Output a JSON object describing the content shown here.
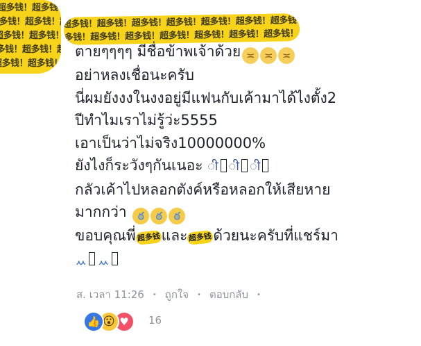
{
  "brush_pattern": "超多钱！超多钱！超多钱！超多钱！超多钱！超多钱！超多钱！",
  "comment": {
    "lines": [
      "ตายๆๆๆๆ มีชื่อข้าพเจ้าด้วย",
      "อย่าหลงเชื่อนะครับ",
      "นี่ผมยังงงในงงอยู่มีแฟนกับเค้ามาได้ไงตั้ง2",
      "ปีทำไมเราไม่รู้ว่ะ5555",
      "เอาเป็นว่าไม่จริง10000000%",
      "ยังไงก็ระวังๆกันเนอะ",
      "กลัวเค้าไปหลอกตังค์หรือหลอกให้เสียหาย",
      "มากกว่า",
      "ขอบคุณพี่",
      "และ",
      "ด้วยนะครับที่แชร์มา"
    ],
    "sticker_text": "超多钱"
  },
  "meta": {
    "timestamp": "ส. เวลา 11:26",
    "like_label": "ถูกใจ",
    "reply_label": "ตอบกลับ"
  },
  "reactions": {
    "icons": [
      "like-icon",
      "wow-icon",
      "love-icon"
    ],
    "count": "16"
  }
}
